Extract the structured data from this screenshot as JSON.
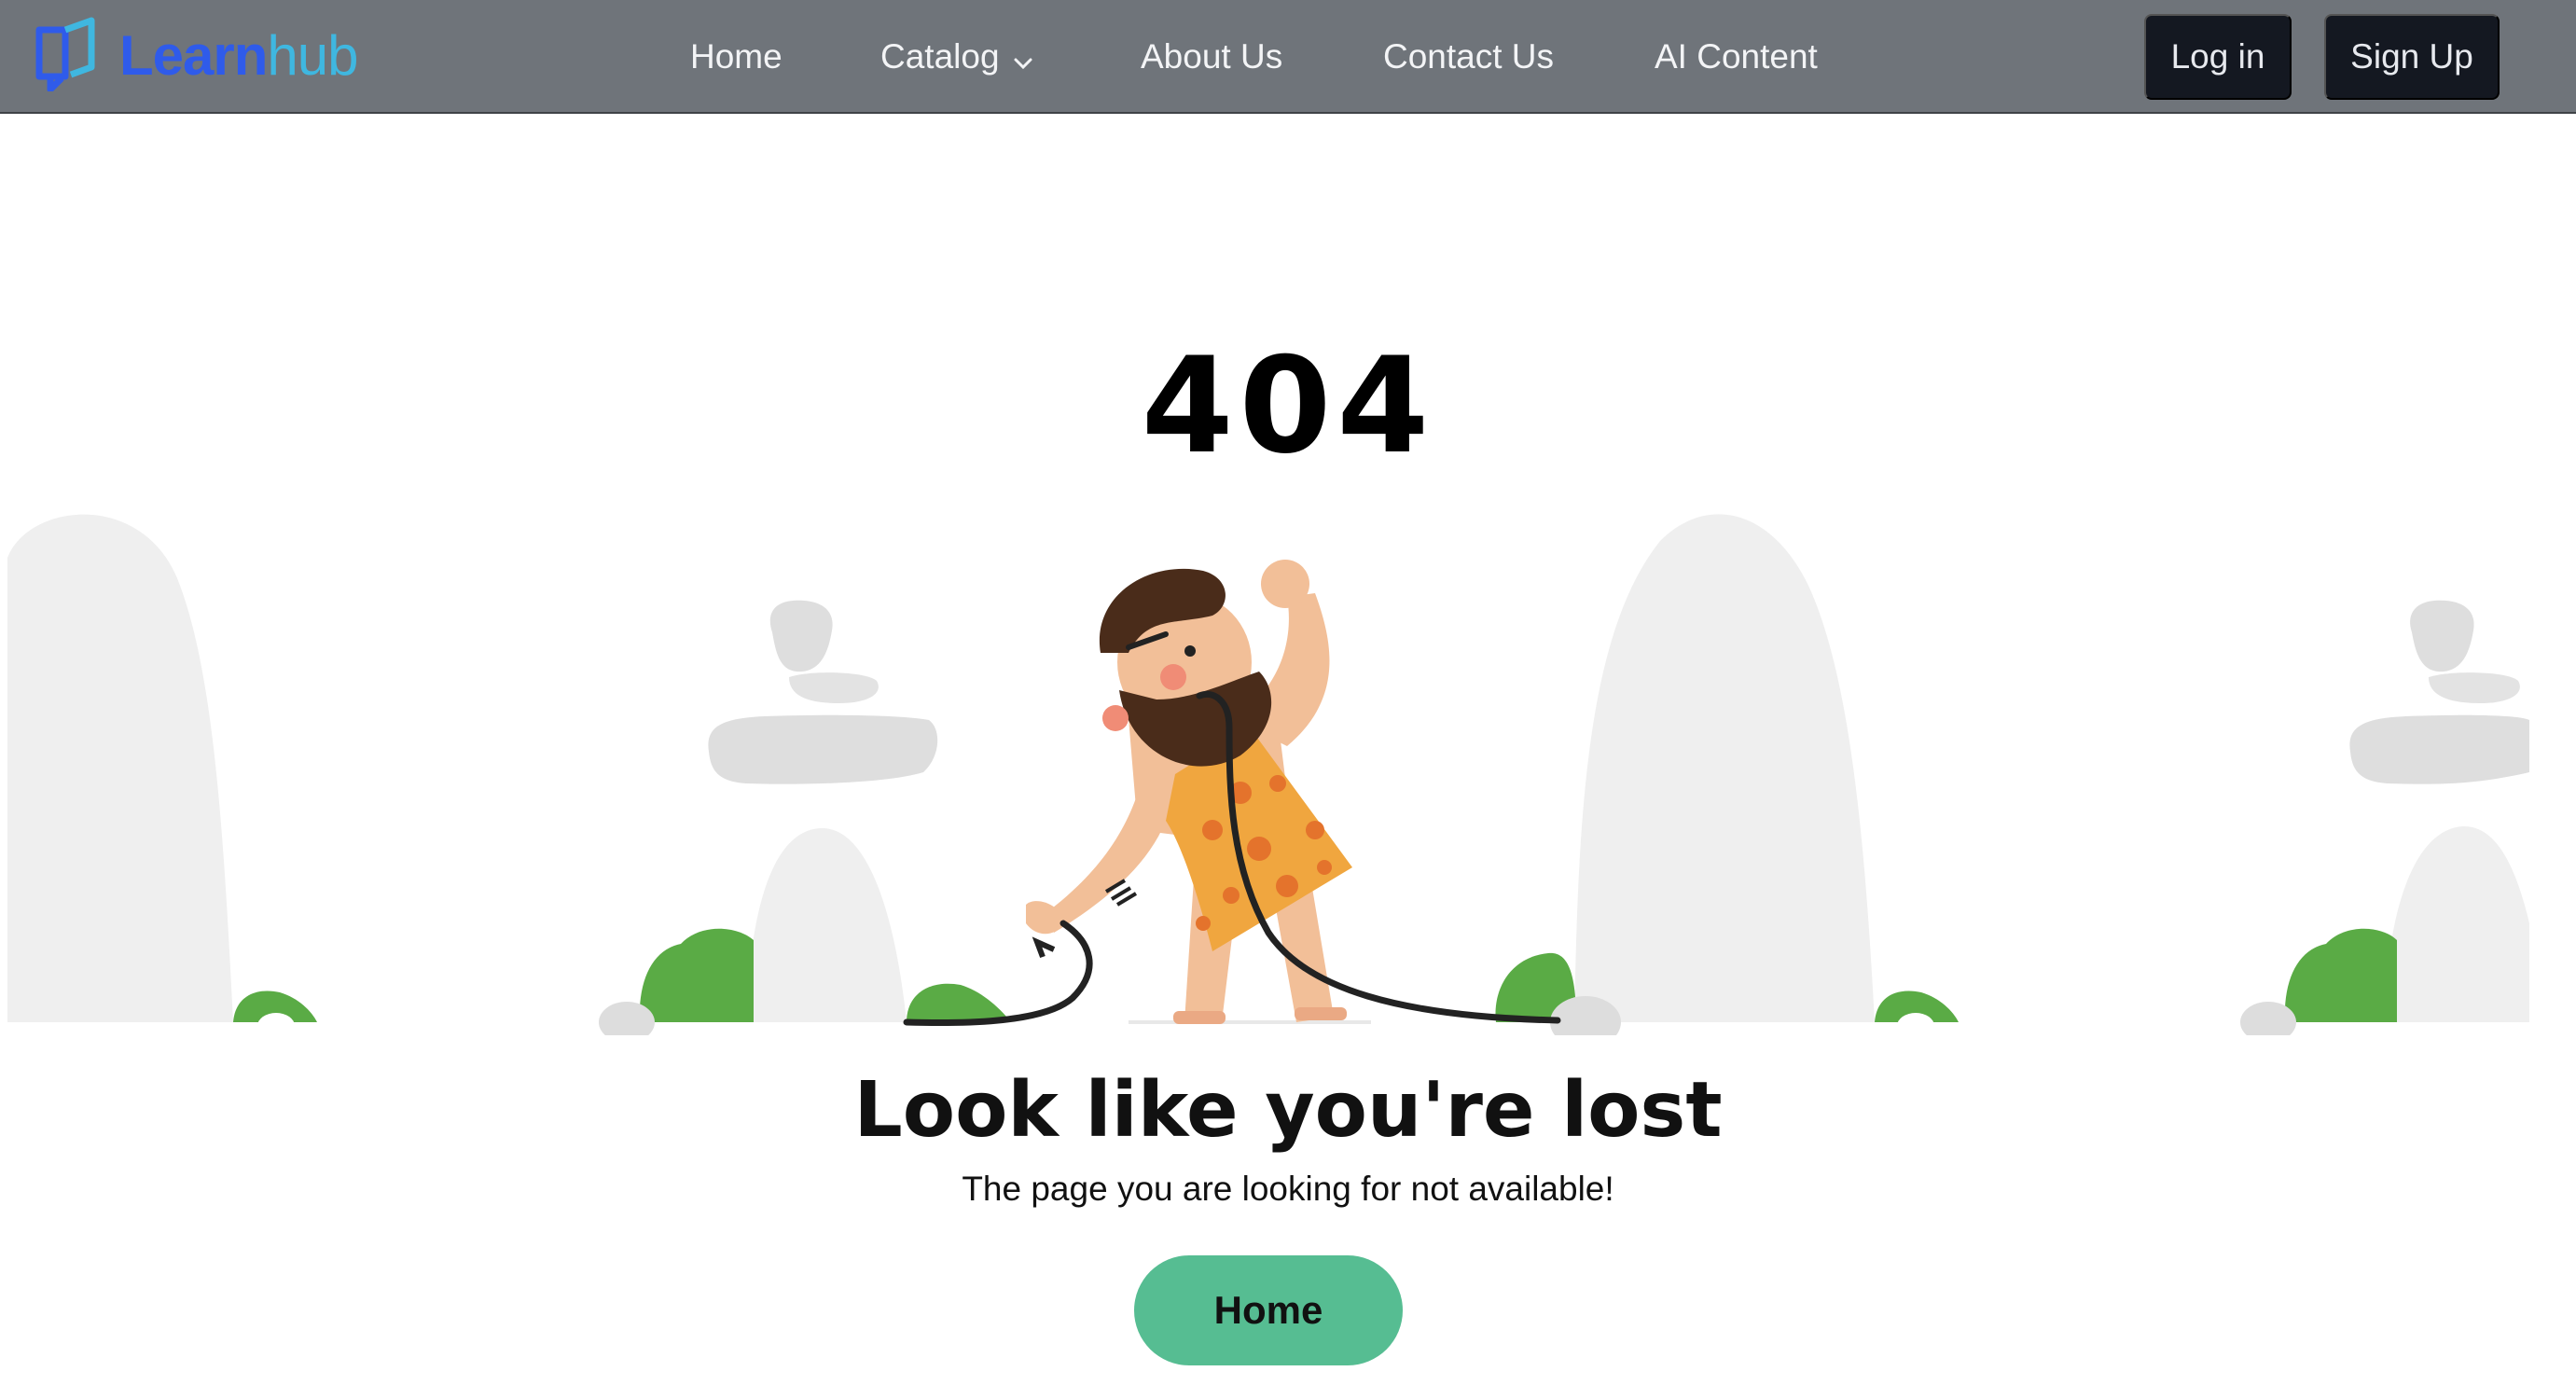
{
  "brand": {
    "learn": "Learn",
    "hub": "hub"
  },
  "nav": {
    "home": "Home",
    "catalog": "Catalog",
    "about": "About Us",
    "contact": "Contact Us",
    "ai": "AI Content"
  },
  "auth": {
    "login": "Log in",
    "signup": "Sign Up"
  },
  "error": {
    "code": "404",
    "title": "Look like you're lost",
    "subtitle": "The page you are looking for not available!",
    "home_button": "Home"
  },
  "colors": {
    "navbar_bg": "#6f747a",
    "brand_primary": "#2f5bea",
    "brand_secondary": "#3fb7e0",
    "auth_button_bg": "#141821",
    "home_button_bg": "#56bd92"
  },
  "icons": {
    "logo": "open-book-chat-icon",
    "catalog_dropdown": "chevron-down-icon"
  }
}
